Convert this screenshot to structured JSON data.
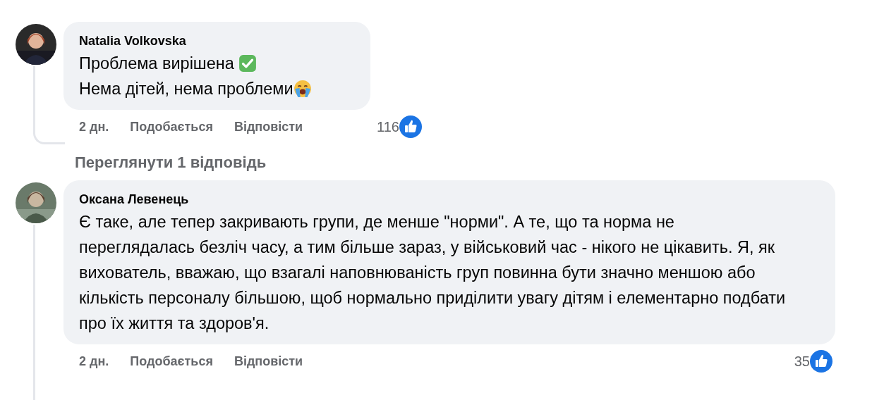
{
  "comments": [
    {
      "author": "Natalia Volkovska",
      "lines": [
        {
          "text": "Проблема вирішена ",
          "kind": "check"
        },
        {
          "text": "Нема дітей, нема проблеми",
          "kind": "crying"
        }
      ],
      "time": "2 дн.",
      "like": "Подобається",
      "reply": "Відповісти",
      "likes": "116",
      "view_replies": "Переглянути 1 відповідь"
    },
    {
      "author": "Оксана Левенець",
      "lines": [
        {
          "text": "Є таке, але тепер закривають групи, де менше \"норми\". А те, що та норма не переглядалась безліч часу, а тим більше зараз, у військовий час - нікого не цікавить. Я, як вихователь, вважаю, що взагалі наповнюваність груп повинна бути значно меншою або кількість персоналу більшою, щоб нормально приділити увагу дітям і елементарно подбати про їх життя та здоров'я."
        }
      ],
      "time": "2 дн.",
      "like": "Подобається",
      "reply": "Відповісти",
      "likes": "35"
    }
  ]
}
